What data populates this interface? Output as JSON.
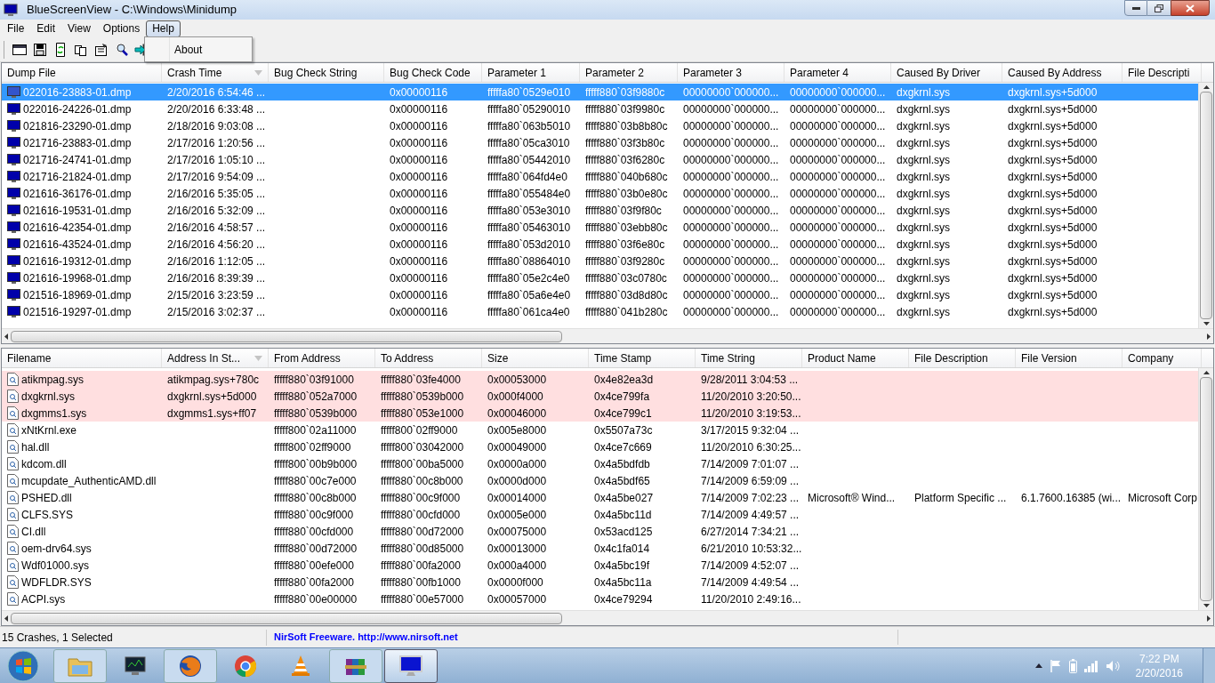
{
  "window": {
    "title": "BlueScreenView  -  C:\\Windows\\Minidump"
  },
  "menu": [
    {
      "label": "File",
      "selected": false
    },
    {
      "label": "Edit",
      "selected": false
    },
    {
      "label": "View",
      "selected": false
    },
    {
      "label": "Options",
      "selected": false
    },
    {
      "label": "Help",
      "selected": true
    }
  ],
  "open_menu": {
    "items": [
      "About"
    ]
  },
  "crash_list": {
    "columns": [
      {
        "label": "Dump File",
        "sorted": false
      },
      {
        "label": "Crash Time",
        "sorted": true
      },
      {
        "label": "Bug Check String",
        "sorted": false
      },
      {
        "label": "Bug Check Code",
        "sorted": false
      },
      {
        "label": "Parameter 1",
        "sorted": false
      },
      {
        "label": "Parameter 2",
        "sorted": false
      },
      {
        "label": "Parameter 3",
        "sorted": false
      },
      {
        "label": "Parameter 4",
        "sorted": false
      },
      {
        "label": "Caused By Driver",
        "sorted": false
      },
      {
        "label": "Caused By Address",
        "sorted": false
      },
      {
        "label": "File Descripti",
        "sorted": false
      }
    ],
    "rows": [
      {
        "selected": true,
        "cells": [
          "022016-23883-01.dmp",
          "2/20/2016 6:54:46 ...",
          null,
          "0x00000116",
          "fffffa80`0529e010",
          "fffff880`03f9880c",
          "00000000`000000...",
          "00000000`000000...",
          "dxgkrnl.sys",
          "dxgkrnl.sys+5d000",
          null
        ]
      },
      {
        "selected": false,
        "cells": [
          "022016-24226-01.dmp",
          "2/20/2016 6:33:48 ...",
          null,
          "0x00000116",
          "fffffa80`05290010",
          "fffff880`03f9980c",
          "00000000`000000...",
          "00000000`000000...",
          "dxgkrnl.sys",
          "dxgkrnl.sys+5d000",
          null
        ]
      },
      {
        "selected": false,
        "cells": [
          "021816-23290-01.dmp",
          "2/18/2016 9:03:08 ...",
          null,
          "0x00000116",
          "fffffa80`063b5010",
          "fffff880`03b8b80c",
          "00000000`000000...",
          "00000000`000000...",
          "dxgkrnl.sys",
          "dxgkrnl.sys+5d000",
          null
        ]
      },
      {
        "selected": false,
        "cells": [
          "021716-23883-01.dmp",
          "2/17/2016 1:20:56 ...",
          null,
          "0x00000116",
          "fffffa80`05ca3010",
          "fffff880`03f3b80c",
          "00000000`000000...",
          "00000000`000000...",
          "dxgkrnl.sys",
          "dxgkrnl.sys+5d000",
          null
        ]
      },
      {
        "selected": false,
        "cells": [
          "021716-24741-01.dmp",
          "2/17/2016 1:05:10 ...",
          null,
          "0x00000116",
          "fffffa80`05442010",
          "fffff880`03f6280c",
          "00000000`000000...",
          "00000000`000000...",
          "dxgkrnl.sys",
          "dxgkrnl.sys+5d000",
          null
        ]
      },
      {
        "selected": false,
        "cells": [
          "021716-21824-01.dmp",
          "2/17/2016 9:54:09 ...",
          null,
          "0x00000116",
          "fffffa80`064fd4e0",
          "fffff880`040b680c",
          "00000000`000000...",
          "00000000`000000...",
          "dxgkrnl.sys",
          "dxgkrnl.sys+5d000",
          null
        ]
      },
      {
        "selected": false,
        "cells": [
          "021616-36176-01.dmp",
          "2/16/2016 5:35:05 ...",
          null,
          "0x00000116",
          "fffffa80`055484e0",
          "fffff880`03b0e80c",
          "00000000`000000...",
          "00000000`000000...",
          "dxgkrnl.sys",
          "dxgkrnl.sys+5d000",
          null
        ]
      },
      {
        "selected": false,
        "cells": [
          "021616-19531-01.dmp",
          "2/16/2016 5:32:09 ...",
          null,
          "0x00000116",
          "fffffa80`053e3010",
          "fffff880`03f9f80c",
          "00000000`000000...",
          "00000000`000000...",
          "dxgkrnl.sys",
          "dxgkrnl.sys+5d000",
          null
        ]
      },
      {
        "selected": false,
        "cells": [
          "021616-42354-01.dmp",
          "2/16/2016 4:58:57 ...",
          null,
          "0x00000116",
          "fffffa80`05463010",
          "fffff880`03ebb80c",
          "00000000`000000...",
          "00000000`000000...",
          "dxgkrnl.sys",
          "dxgkrnl.sys+5d000",
          null
        ]
      },
      {
        "selected": false,
        "cells": [
          "021616-43524-01.dmp",
          "2/16/2016 4:56:20 ...",
          null,
          "0x00000116",
          "fffffa80`053d2010",
          "fffff880`03f6e80c",
          "00000000`000000...",
          "00000000`000000...",
          "dxgkrnl.sys",
          "dxgkrnl.sys+5d000",
          null
        ]
      },
      {
        "selected": false,
        "cells": [
          "021616-19312-01.dmp",
          "2/16/2016 1:12:05 ...",
          null,
          "0x00000116",
          "fffffa80`08864010",
          "fffff880`03f9280c",
          "00000000`000000...",
          "00000000`000000...",
          "dxgkrnl.sys",
          "dxgkrnl.sys+5d000",
          null
        ]
      },
      {
        "selected": false,
        "cells": [
          "021616-19968-01.dmp",
          "2/16/2016 8:39:39 ...",
          null,
          "0x00000116",
          "fffffa80`05e2c4e0",
          "fffff880`03c0780c",
          "00000000`000000...",
          "00000000`000000...",
          "dxgkrnl.sys",
          "dxgkrnl.sys+5d000",
          null
        ]
      },
      {
        "selected": false,
        "cells": [
          "021516-18969-01.dmp",
          "2/15/2016 3:23:59 ...",
          null,
          "0x00000116",
          "fffffa80`05a6e4e0",
          "fffff880`03d8d80c",
          "00000000`000000...",
          "00000000`000000...",
          "dxgkrnl.sys",
          "dxgkrnl.sys+5d000",
          null
        ]
      },
      {
        "selected": false,
        "cells": [
          "021516-19297-01.dmp",
          "2/15/2016 3:02:37 ...",
          null,
          "0x00000116",
          "fffffa80`061ca4e0",
          "fffff880`041b280c",
          "00000000`000000...",
          "00000000`000000...",
          "dxgkrnl.sys",
          "dxgkrnl.sys+5d000",
          null
        ]
      }
    ]
  },
  "module_list": {
    "columns": [
      {
        "label": "Filename",
        "sorted": false
      },
      {
        "label": "Address In St...",
        "sorted": true
      },
      {
        "label": "From Address",
        "sorted": false
      },
      {
        "label": "To Address",
        "sorted": false
      },
      {
        "label": "Size",
        "sorted": false
      },
      {
        "label": "Time Stamp",
        "sorted": false
      },
      {
        "label": "Time String",
        "sorted": false
      },
      {
        "label": "Product Name",
        "sorted": false
      },
      {
        "label": "File Description",
        "sorted": false
      },
      {
        "label": "File Version",
        "sorted": false
      },
      {
        "label": "Company",
        "sorted": false
      }
    ],
    "rows": [
      {
        "highlighted": true,
        "cells": [
          "atikmpag.sys",
          "atikmpag.sys+780c",
          "fffff880`03f91000",
          "fffff880`03fe4000",
          "0x00053000",
          "0x4e82ea3d",
          "9/28/2011 3:04:53 ...",
          null,
          null,
          null,
          null
        ]
      },
      {
        "highlighted": true,
        "cells": [
          "dxgkrnl.sys",
          "dxgkrnl.sys+5d000",
          "fffff880`052a7000",
          "fffff880`0539b000",
          "0x000f4000",
          "0x4ce799fa",
          "11/20/2010 3:20:50...",
          null,
          null,
          null,
          null
        ]
      },
      {
        "highlighted": true,
        "cells": [
          "dxgmms1.sys",
          "dxgmms1.sys+ff07",
          "fffff880`0539b000",
          "fffff880`053e1000",
          "0x00046000",
          "0x4ce799c1",
          "11/20/2010 3:19:53...",
          null,
          null,
          null,
          null
        ]
      },
      {
        "highlighted": false,
        "cells": [
          "xNtKrnl.exe",
          null,
          "fffff800`02a11000",
          "fffff800`02ff9000",
          "0x005e8000",
          "0x5507a73c",
          "3/17/2015 9:32:04 ...",
          null,
          null,
          null,
          null
        ]
      },
      {
        "highlighted": false,
        "cells": [
          "hal.dll",
          null,
          "fffff800`02ff9000",
          "fffff800`03042000",
          "0x00049000",
          "0x4ce7c669",
          "11/20/2010 6:30:25...",
          null,
          null,
          null,
          null
        ]
      },
      {
        "highlighted": false,
        "cells": [
          "kdcom.dll",
          null,
          "fffff800`00b9b000",
          "fffff800`00ba5000",
          "0x0000a000",
          "0x4a5bdfdb",
          "7/14/2009 7:01:07 ...",
          null,
          null,
          null,
          null
        ]
      },
      {
        "highlighted": false,
        "cells": [
          "mcupdate_AuthenticAMD.dll",
          null,
          "fffff880`00c7e000",
          "fffff880`00c8b000",
          "0x0000d000",
          "0x4a5bdf65",
          "7/14/2009 6:59:09 ...",
          null,
          null,
          null,
          null
        ]
      },
      {
        "highlighted": false,
        "cells": [
          "PSHED.dll",
          null,
          "fffff880`00c8b000",
          "fffff880`00c9f000",
          "0x00014000",
          "0x4a5be027",
          "7/14/2009 7:02:23 ...",
          "Microsoft® Wind...",
          "Platform Specific ...",
          "6.1.7600.16385 (wi...",
          "Microsoft Corp"
        ]
      },
      {
        "highlighted": false,
        "cells": [
          "CLFS.SYS",
          null,
          "fffff880`00c9f000",
          "fffff880`00cfd000",
          "0x0005e000",
          "0x4a5bc11d",
          "7/14/2009 4:49:57 ...",
          null,
          null,
          null,
          null
        ]
      },
      {
        "highlighted": false,
        "cells": [
          "CI.dll",
          null,
          "fffff880`00cfd000",
          "fffff880`00d72000",
          "0x00075000",
          "0x53acd125",
          "6/27/2014 7:34:21 ...",
          null,
          null,
          null,
          null
        ]
      },
      {
        "highlighted": false,
        "cells": [
          "oem-drv64.sys",
          null,
          "fffff880`00d72000",
          "fffff880`00d85000",
          "0x00013000",
          "0x4c1fa014",
          "6/21/2010 10:53:32...",
          null,
          null,
          null,
          null
        ]
      },
      {
        "highlighted": false,
        "cells": [
          "Wdf01000.sys",
          null,
          "fffff880`00efe000",
          "fffff880`00fa2000",
          "0x000a4000",
          "0x4a5bc19f",
          "7/14/2009 4:52:07 ...",
          null,
          null,
          null,
          null
        ]
      },
      {
        "highlighted": false,
        "cells": [
          "WDFLDR.SYS",
          null,
          "fffff880`00fa2000",
          "fffff880`00fb1000",
          "0x0000f000",
          "0x4a5bc11a",
          "7/14/2009 4:49:54 ...",
          null,
          null,
          null,
          null
        ]
      },
      {
        "highlighted": false,
        "cells": [
          "ACPI.sys",
          null,
          "fffff880`00e00000",
          "fffff880`00e57000",
          "0x00057000",
          "0x4ce79294",
          "11/20/2010 2:49:16...",
          null,
          null,
          null,
          null
        ]
      }
    ]
  },
  "status_bar": {
    "count": "15 Crashes, 1 Selected",
    "link": "NirSoft Freeware.  http://www.nirsoft.net"
  },
  "taskbar": {
    "apps": [
      {
        "kind": "folder",
        "active": false
      },
      {
        "kind": "monitor",
        "active": false
      },
      {
        "kind": "firefox",
        "active": false
      },
      {
        "kind": "chrome",
        "active": false
      },
      {
        "kind": "cone",
        "active": false
      },
      {
        "kind": "books",
        "active": false
      },
      {
        "kind": "bluescreen",
        "active": true
      }
    ],
    "time": "7:22 PM",
    "date": "2/20/2016"
  }
}
